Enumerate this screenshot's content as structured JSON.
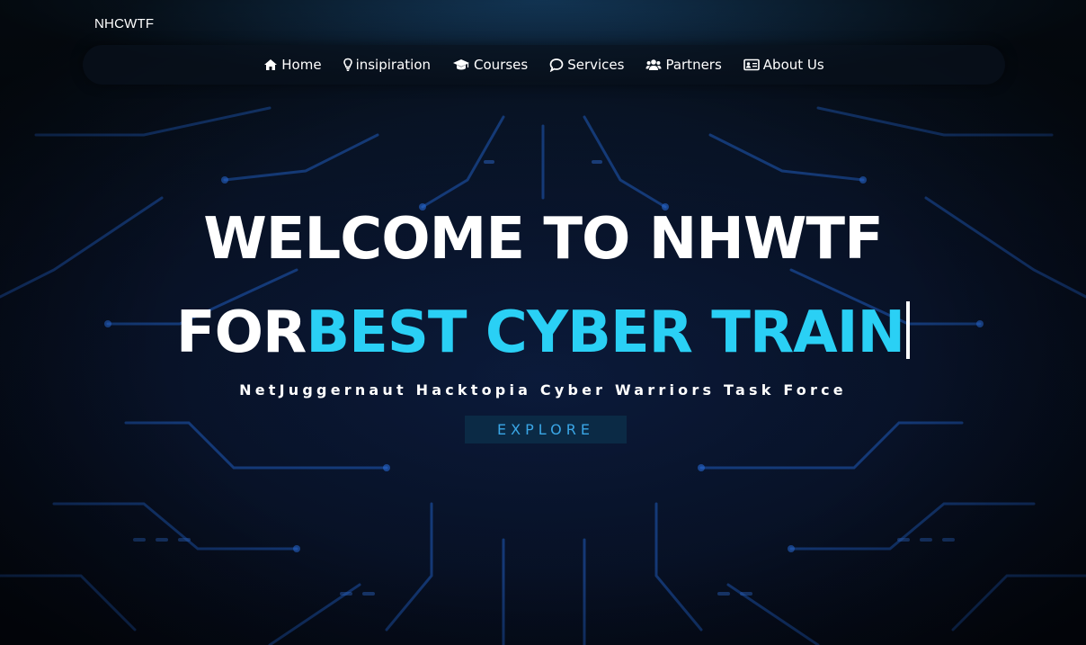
{
  "brand": {
    "name": "NHCWTF"
  },
  "nav": {
    "items": [
      {
        "label": "Home",
        "icon": "home-icon"
      },
      {
        "label": "insipiration",
        "icon": "lightbulb-icon"
      },
      {
        "label": "Courses",
        "icon": "graduation-cap-icon"
      },
      {
        "label": "Services",
        "icon": "comment-icon"
      },
      {
        "label": "Partners",
        "icon": "users-icon"
      },
      {
        "label": "About Us",
        "icon": "id-card-icon"
      }
    ]
  },
  "hero": {
    "line1": "WELCOME TO NHWTF",
    "line2_prefix": "FOR",
    "line2_typed": "BEST CYBER TRAIN",
    "tagline": "NetJuggernaut Hacktopia Cyber Warriors Task Force",
    "cta_label": "EXPLORE"
  },
  "colors": {
    "accent": "#2ad0f5",
    "cta_text": "#3aa6e6",
    "cta_bg": "#0b2a45",
    "background": "#04070d"
  }
}
